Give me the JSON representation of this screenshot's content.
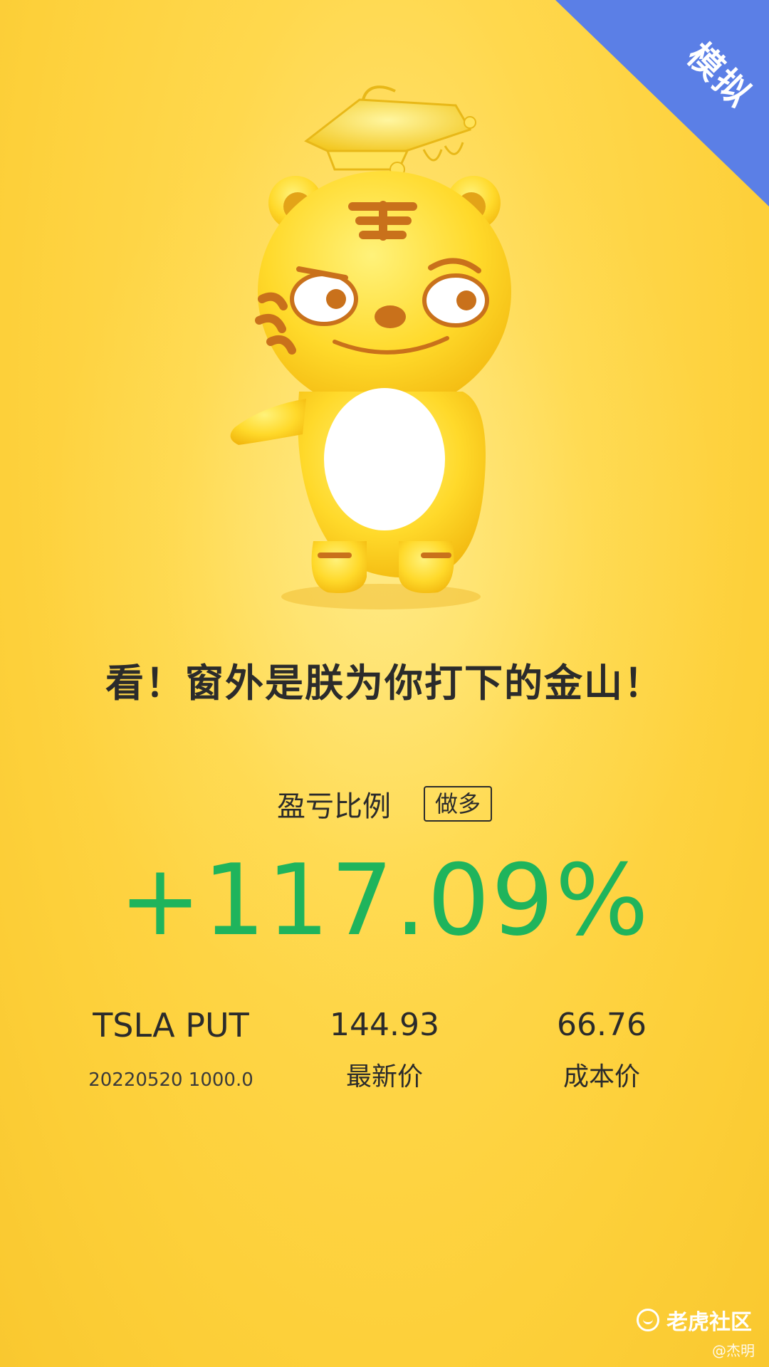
{
  "badge": {
    "label": "模拟",
    "color": "#5b7fe6"
  },
  "mascot": {
    "icon": "tiger-mascot-with-graduation-cap"
  },
  "slogan": "看！窗外是朕为你打下的金山！",
  "profit_loss": {
    "label": "盈亏比例",
    "direction_tag": "做多",
    "value": "+117.09%",
    "value_color": "#1fb45c"
  },
  "position": {
    "symbol": "TSLA PUT",
    "contract": "20220520 1000.0",
    "latest_price": "144.93",
    "latest_price_label": "最新价",
    "cost_price": "66.76",
    "cost_price_label": "成本价"
  },
  "watermark": {
    "brand": "老虎社区",
    "author": "@杰明",
    "brand_icon": "tiger-community-logo-icon"
  }
}
